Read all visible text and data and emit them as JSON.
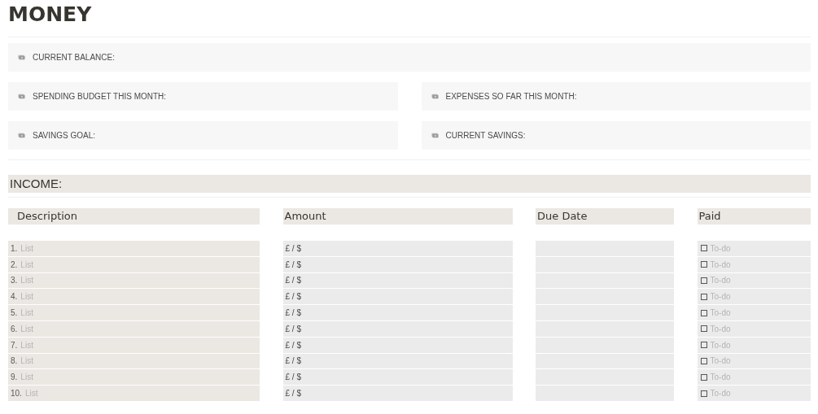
{
  "title": "MONEY",
  "callouts": [
    [
      {
        "label": "CURRENT BALANCE:"
      }
    ],
    [
      {
        "label": "SPENDING BUDGET THIS MONTH:"
      },
      {
        "label": "EXPENSES SO FAR THIS MONTH:"
      }
    ],
    [
      {
        "label": "SAVINGS GOAL:"
      },
      {
        "label": "CURRENT SAVINGS:"
      }
    ]
  ],
  "section": {
    "heading": "INCOME:"
  },
  "table": {
    "columns": [
      "Description",
      "Amount",
      "Due Date",
      "Paid"
    ],
    "rows": [
      {
        "number": "1.",
        "description_placeholder": "List",
        "amount": "£ / $",
        "paid": {
          "checked": false,
          "placeholder": "To-do"
        }
      },
      {
        "number": "2.",
        "description_placeholder": "List",
        "amount": "£ / $",
        "paid": {
          "checked": false,
          "placeholder": "To-do"
        }
      },
      {
        "number": "3.",
        "description_placeholder": "List",
        "amount": "£ / $",
        "paid": {
          "checked": false,
          "placeholder": "To-do"
        }
      },
      {
        "number": "4.",
        "description_placeholder": "List",
        "amount": "£ / $",
        "paid": {
          "checked": false,
          "placeholder": "To-do"
        }
      },
      {
        "number": "5.",
        "description_placeholder": "List",
        "amount": "£ / $",
        "paid": {
          "checked": false,
          "placeholder": "To-do"
        }
      },
      {
        "number": "6.",
        "description_placeholder": "List",
        "amount": "£ / $",
        "paid": {
          "checked": false,
          "placeholder": "To-do"
        }
      },
      {
        "number": "7.",
        "description_placeholder": "List",
        "amount": "£ / $",
        "paid": {
          "checked": false,
          "placeholder": "To-do"
        }
      },
      {
        "number": "8.",
        "description_placeholder": "List",
        "amount": "£ / $",
        "paid": {
          "checked": false,
          "placeholder": "To-do"
        }
      },
      {
        "number": "9.",
        "description_placeholder": "List",
        "amount": "£ / $",
        "paid": {
          "checked": false,
          "placeholder": "To-do"
        }
      },
      {
        "number": "10.",
        "description_placeholder": "List",
        "amount": "£ / $",
        "paid": {
          "checked": false,
          "placeholder": "To-do"
        }
      }
    ]
  }
}
